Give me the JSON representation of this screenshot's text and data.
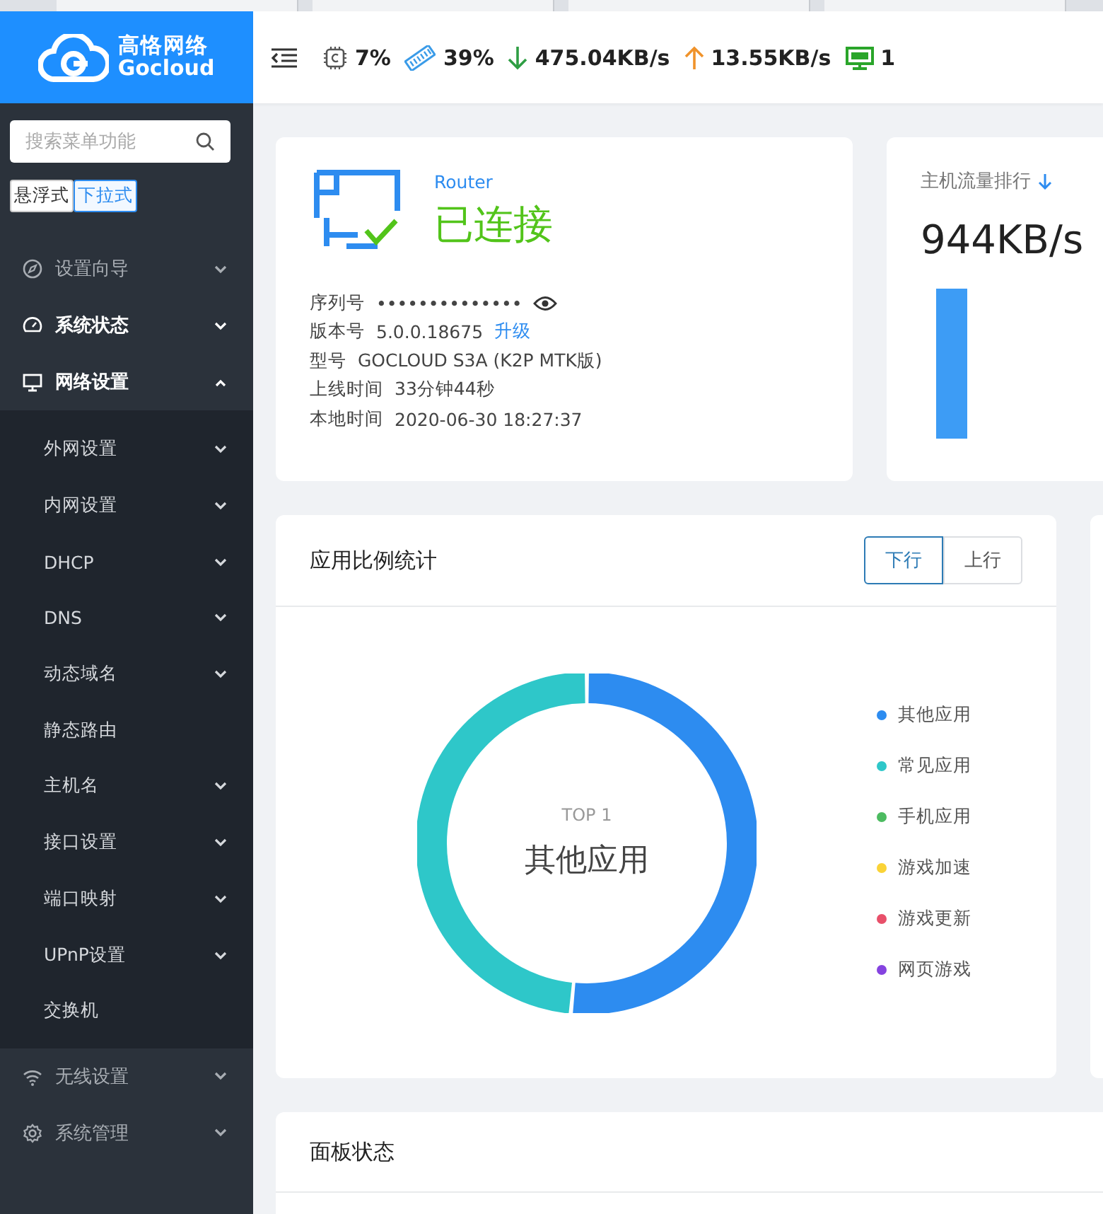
{
  "logo": {
    "name": "高恪网络",
    "sub": "Gocloud"
  },
  "toolbar": {
    "cpu": "7%",
    "memory": "39%",
    "download": "475.04KB/s",
    "upload": "13.55KB/s",
    "devices": "1"
  },
  "sidebar": {
    "search": {
      "placeholder": "搜索菜单功能"
    },
    "modes": [
      {
        "label": "悬浮式",
        "selected": false
      },
      {
        "label": "下拉式",
        "selected": true
      }
    ],
    "items": [
      {
        "label": "设置向导",
        "highlighted": false,
        "expanded": false
      },
      {
        "label": "系统状态",
        "highlighted": true,
        "expanded": false
      },
      {
        "label": "网络设置",
        "highlighted": true,
        "expanded": true,
        "children": [
          {
            "label": "外网设置",
            "kind": "submenu"
          },
          {
            "label": "内网设置",
            "kind": "submenu"
          },
          {
            "label": "DHCP",
            "kind": "submenu"
          },
          {
            "label": "DNS",
            "kind": "submenu"
          },
          {
            "label": "动态域名",
            "kind": "submenu"
          },
          {
            "label": "静态路由",
            "kind": "link"
          },
          {
            "label": "主机名",
            "kind": "submenu"
          },
          {
            "label": "接口设置",
            "kind": "submenu"
          },
          {
            "label": "端口映射",
            "kind": "submenu"
          },
          {
            "label": "UPnP设置",
            "kind": "submenu"
          },
          {
            "label": "交换机",
            "kind": "link"
          }
        ]
      },
      {
        "label": "无线设置",
        "highlighted": false,
        "expanded": false
      },
      {
        "label": "系统管理",
        "highlighted": false,
        "expanded": false
      }
    ]
  },
  "device_card": {
    "type": "Router",
    "status": "已连接",
    "fields": [
      {
        "label": "序列号",
        "value": "••••••••••••••",
        "masked": true
      },
      {
        "label": "版本号",
        "value": "5.0.0.18675",
        "link": "升级",
        "masked": false
      },
      {
        "label": "型号",
        "value": "GOCLOUD S3A (K2P MTK版)",
        "masked": false
      },
      {
        "label": "上线时间",
        "value": "33分钟44秒",
        "masked": false
      },
      {
        "label": "本地时间",
        "value": "2020-06-30 18:27:37",
        "masked": false
      }
    ]
  },
  "traffic_card": {
    "title": "主机流量排行",
    "value": "944KB/s"
  },
  "app_stats": {
    "title": "应用比例统计",
    "toggle": [
      {
        "label": "下行",
        "selected": true
      },
      {
        "label": "上行",
        "selected": false
      }
    ],
    "center_label": "TOP 1",
    "center_value": "其他应用",
    "legend": [
      {
        "label": "其他应用",
        "color": "#2d8cf0"
      },
      {
        "label": "常见应用",
        "color": "#2ec7c9"
      },
      {
        "label": "手机应用",
        "color": "#4cbb60"
      },
      {
        "label": "游戏加速",
        "color": "#fad337"
      },
      {
        "label": "游戏更新",
        "color": "#e8506a"
      },
      {
        "label": "网页游戏",
        "color": "#8543e0"
      }
    ]
  },
  "panel_card": {
    "title": "面板状态"
  }
}
